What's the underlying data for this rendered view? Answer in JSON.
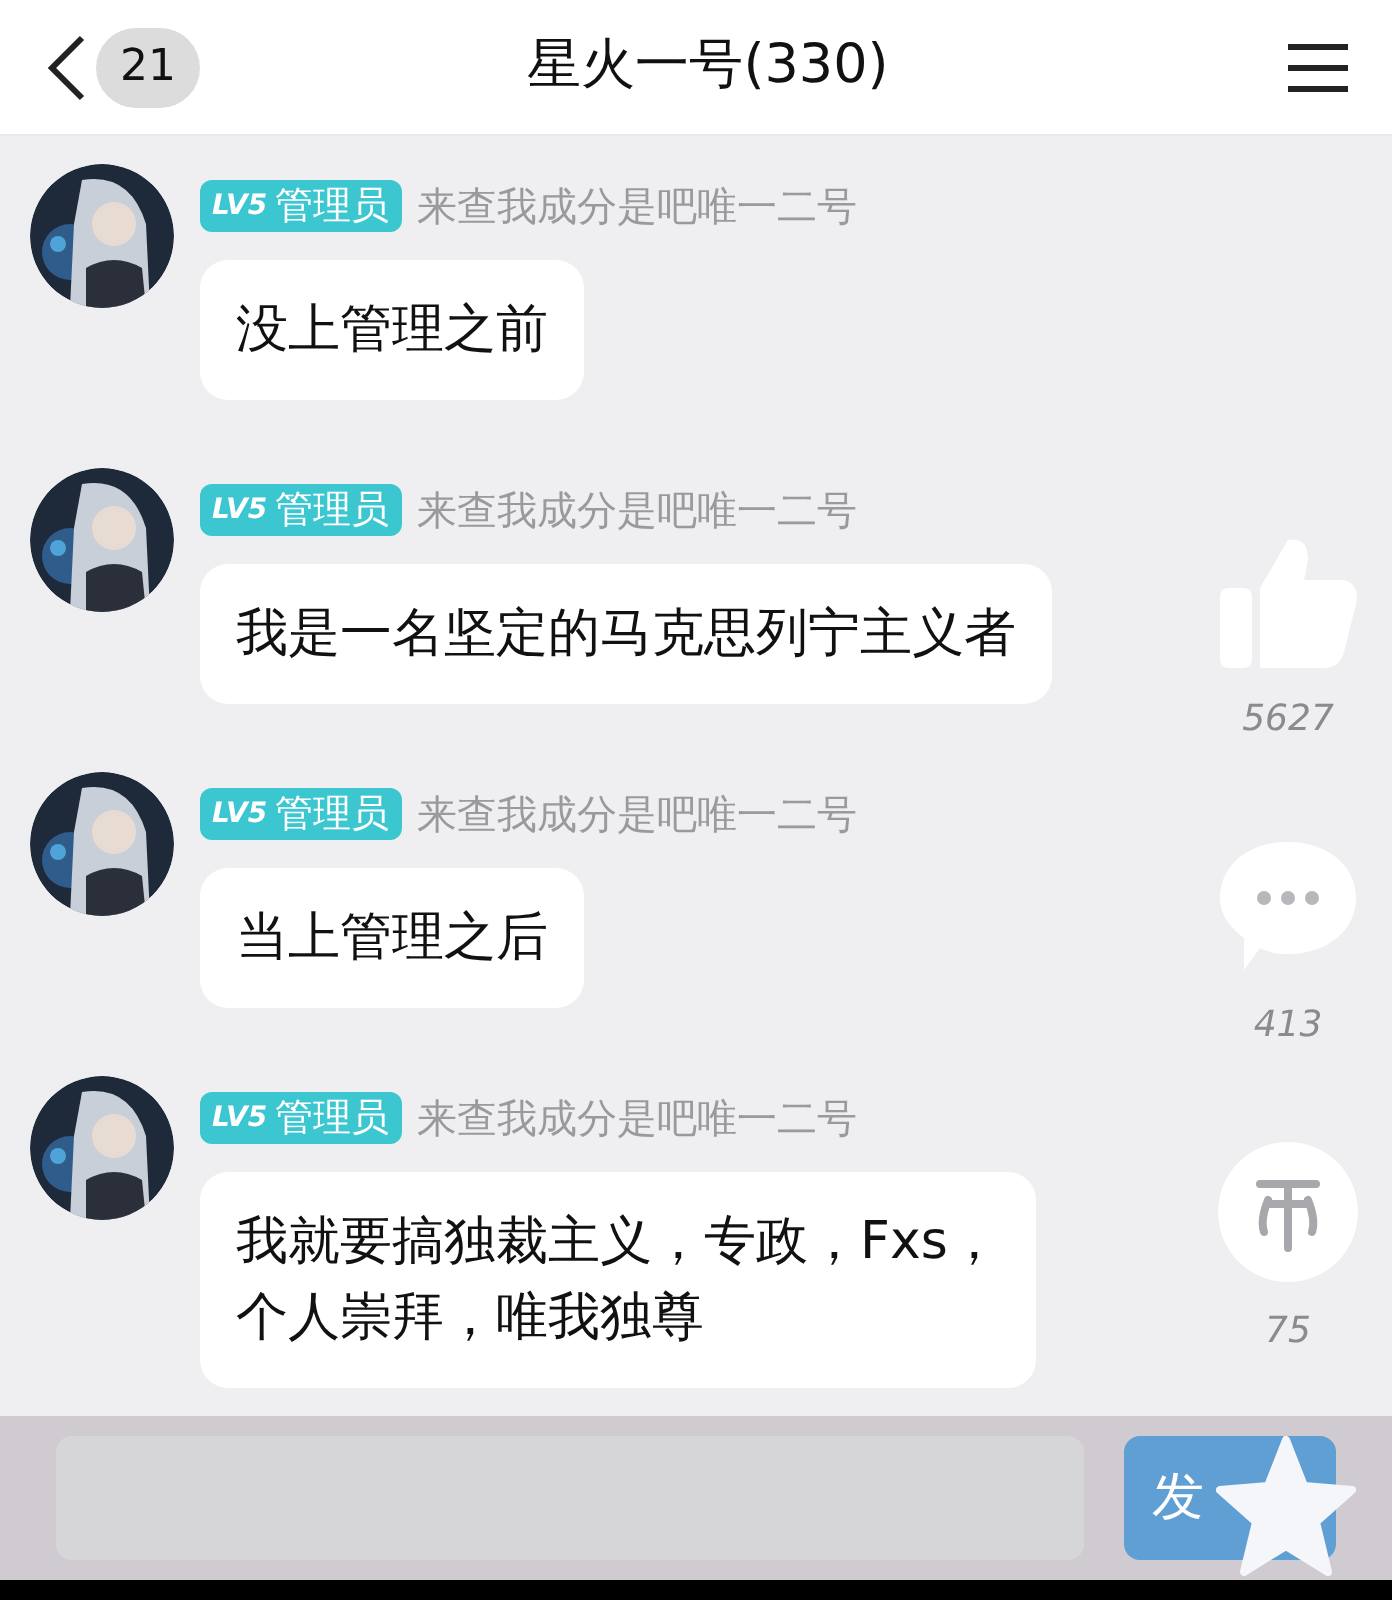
{
  "header": {
    "unread_count": "21",
    "title": "星火一号(330)"
  },
  "messages": [
    {
      "badge_level": "LV5",
      "badge_role": "管理员",
      "sender": "来查我成分是吧唯一二号",
      "text": "没上管理之前"
    },
    {
      "badge_level": "LV5",
      "badge_role": "管理员",
      "sender": "来查我成分是吧唯一二号",
      "text": "我是一名坚定的马克思列宁主义者"
    },
    {
      "badge_level": "LV5",
      "badge_role": "管理员",
      "sender": "来查我成分是吧唯一二号",
      "text": "当上管理之后"
    },
    {
      "badge_level": "LV5",
      "badge_role": "管理员",
      "sender": "来查我成分是吧唯一二号",
      "lines": [
        "我就要搞独裁主义，专政，Fxs，",
        "个人崇拜，唯我独尊"
      ]
    }
  ],
  "actions": [
    {
      "kind": "like",
      "count": "5627"
    },
    {
      "kind": "comment",
      "count": "413"
    },
    {
      "kind": "coin",
      "count": "75"
    }
  ],
  "input_bar": {
    "send_label": "发"
  }
}
